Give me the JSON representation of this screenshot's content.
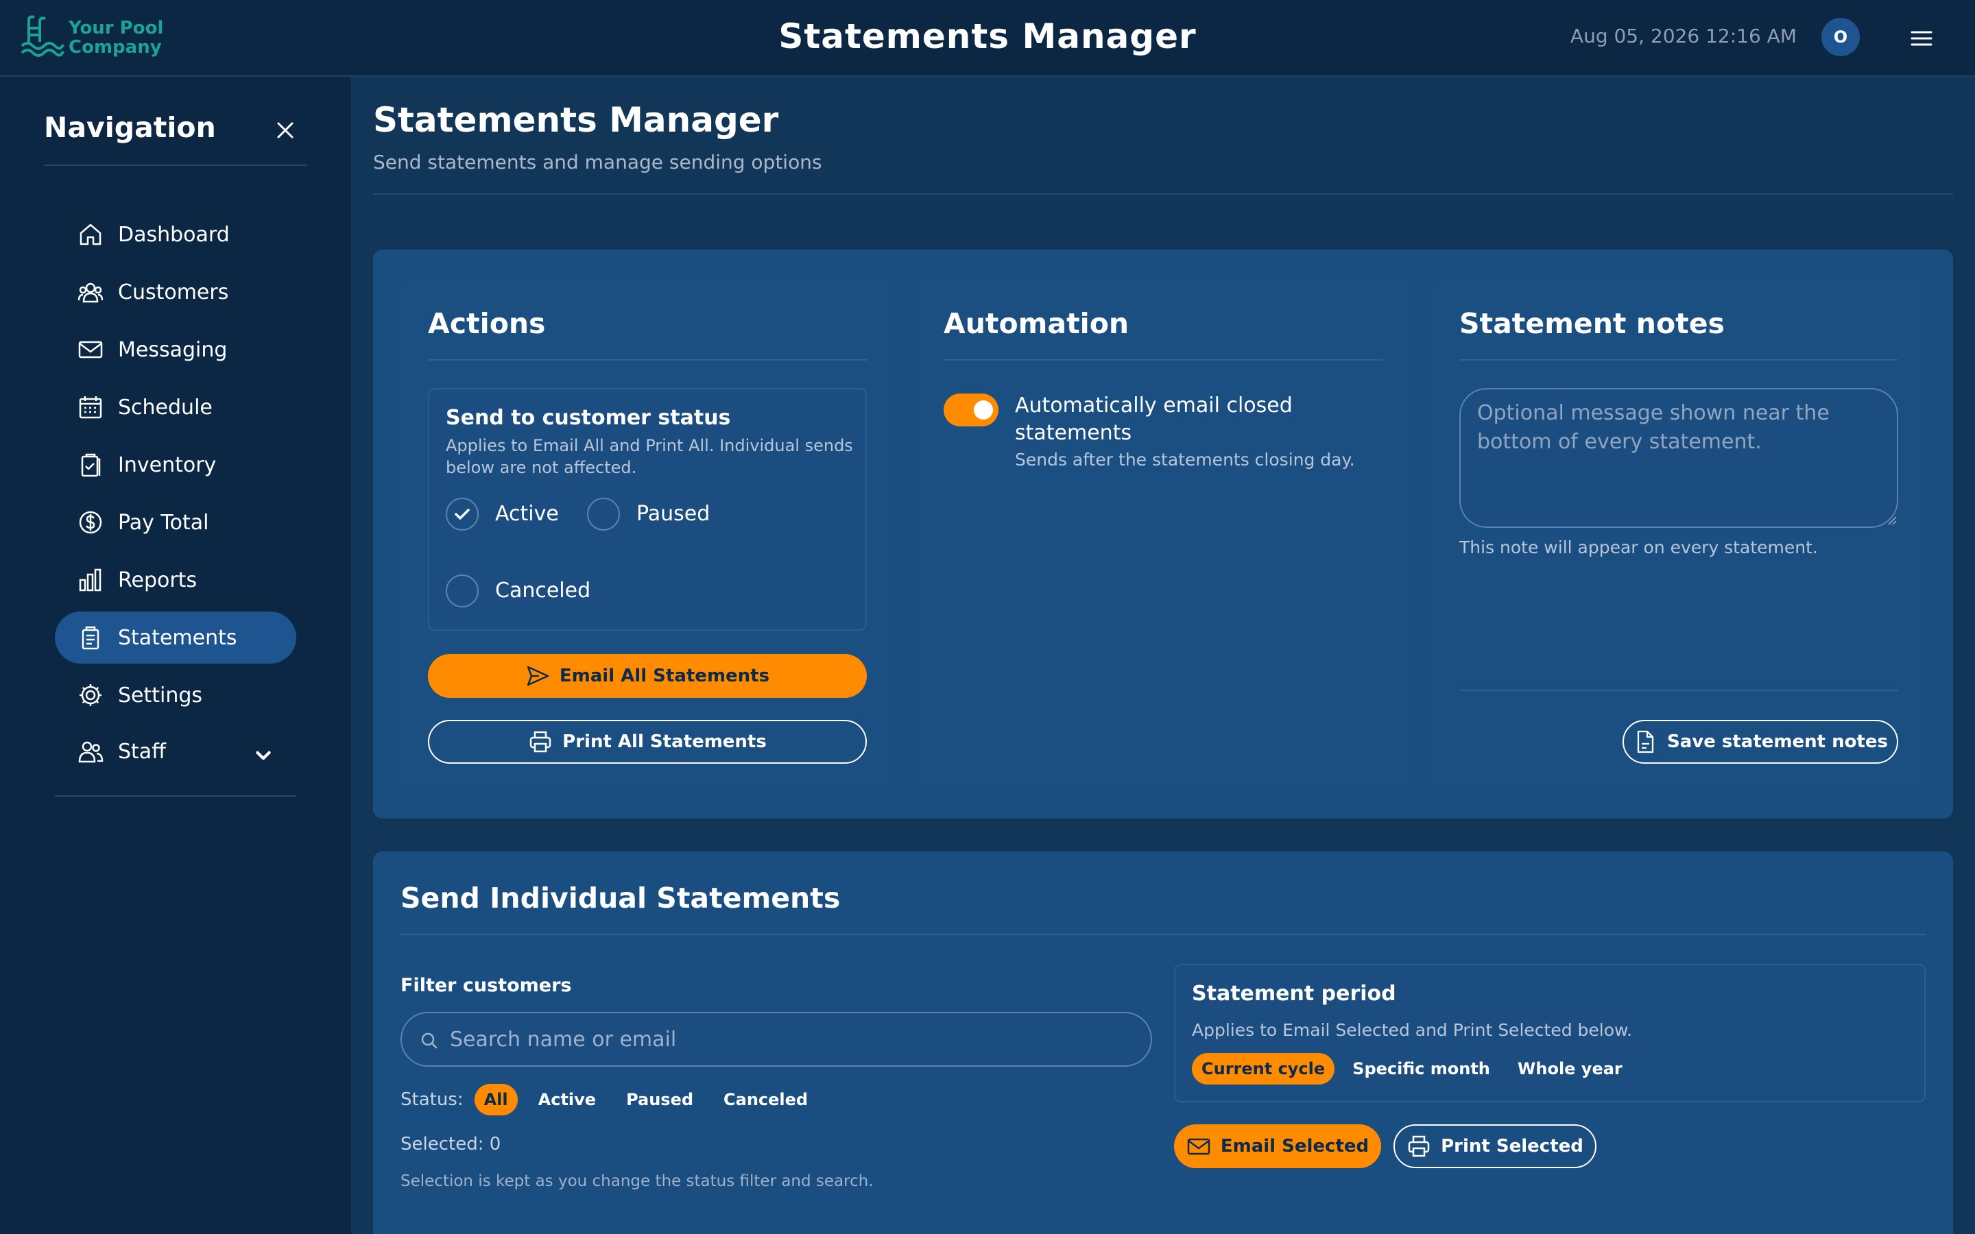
{
  "header": {
    "logo_text": "Your Pool Company",
    "title": "Statements Manager",
    "datetime": "Aug 05, 2026 12:16 AM",
    "avatar_initial": "O"
  },
  "nav": {
    "title": "Navigation",
    "items": [
      {
        "label": "Dashboard",
        "icon": "home-icon"
      },
      {
        "label": "Customers",
        "icon": "users-icon"
      },
      {
        "label": "Messaging",
        "icon": "mail-icon"
      },
      {
        "label": "Schedule",
        "icon": "calendar-icon"
      },
      {
        "label": "Inventory",
        "icon": "clipboard-check-icon"
      },
      {
        "label": "Pay Total",
        "icon": "dollar-icon"
      },
      {
        "label": "Reports",
        "icon": "bar-chart-icon"
      },
      {
        "label": "Statements",
        "icon": "document-stack-icon",
        "active": true
      },
      {
        "label": "Settings",
        "icon": "gear-icon"
      },
      {
        "label": "Staff",
        "icon": "staff-icon",
        "expandable": true
      }
    ]
  },
  "page": {
    "title": "Statements Manager",
    "subtitle": "Send statements and manage sending options"
  },
  "actions": {
    "title": "Actions",
    "status_box": {
      "title": "Send to customer status",
      "description": "Applies to Email All and Print All. Individual sends below are not affected.",
      "options": [
        {
          "label": "Active",
          "checked": true
        },
        {
          "label": "Paused",
          "checked": false
        },
        {
          "label": "Canceled",
          "checked": false
        }
      ]
    },
    "email_all_label": "Email All Statements",
    "print_all_label": "Print All Statements"
  },
  "automation": {
    "title": "Automation",
    "toggle_on": true,
    "label": "Automatically email closed statements",
    "hint": "Sends after the statements closing day."
  },
  "notes": {
    "title": "Statement notes",
    "placeholder": "Optional message shown near the bottom of every statement.",
    "value": "",
    "hint": "This note will appear on every statement.",
    "save_label": "Save statement notes"
  },
  "individual": {
    "title": "Send Individual Statements",
    "filter_label": "Filter customers",
    "search_placeholder": "Search name or email",
    "status_label": "Status:",
    "status_chips": [
      "All",
      "Active",
      "Paused",
      "Canceled"
    ],
    "status_selected": "All",
    "selected_text": "Selected: 0",
    "selection_hint": "Selection is kept as you change the status filter and search.",
    "period": {
      "title": "Statement period",
      "description": "Applies to Email Selected and Print Selected below.",
      "options": [
        "Current cycle",
        "Specific month",
        "Whole year"
      ],
      "selected": "Current cycle"
    },
    "email_selected_label": "Email Selected",
    "print_selected_label": "Print Selected"
  },
  "colors": {
    "accent": "#ff8c00",
    "topbar": "#0c2744",
    "sidebar": "#0b2744",
    "panel": "#1a4d80",
    "active_nav": "#1e5590",
    "logo": "#1aa39a"
  }
}
